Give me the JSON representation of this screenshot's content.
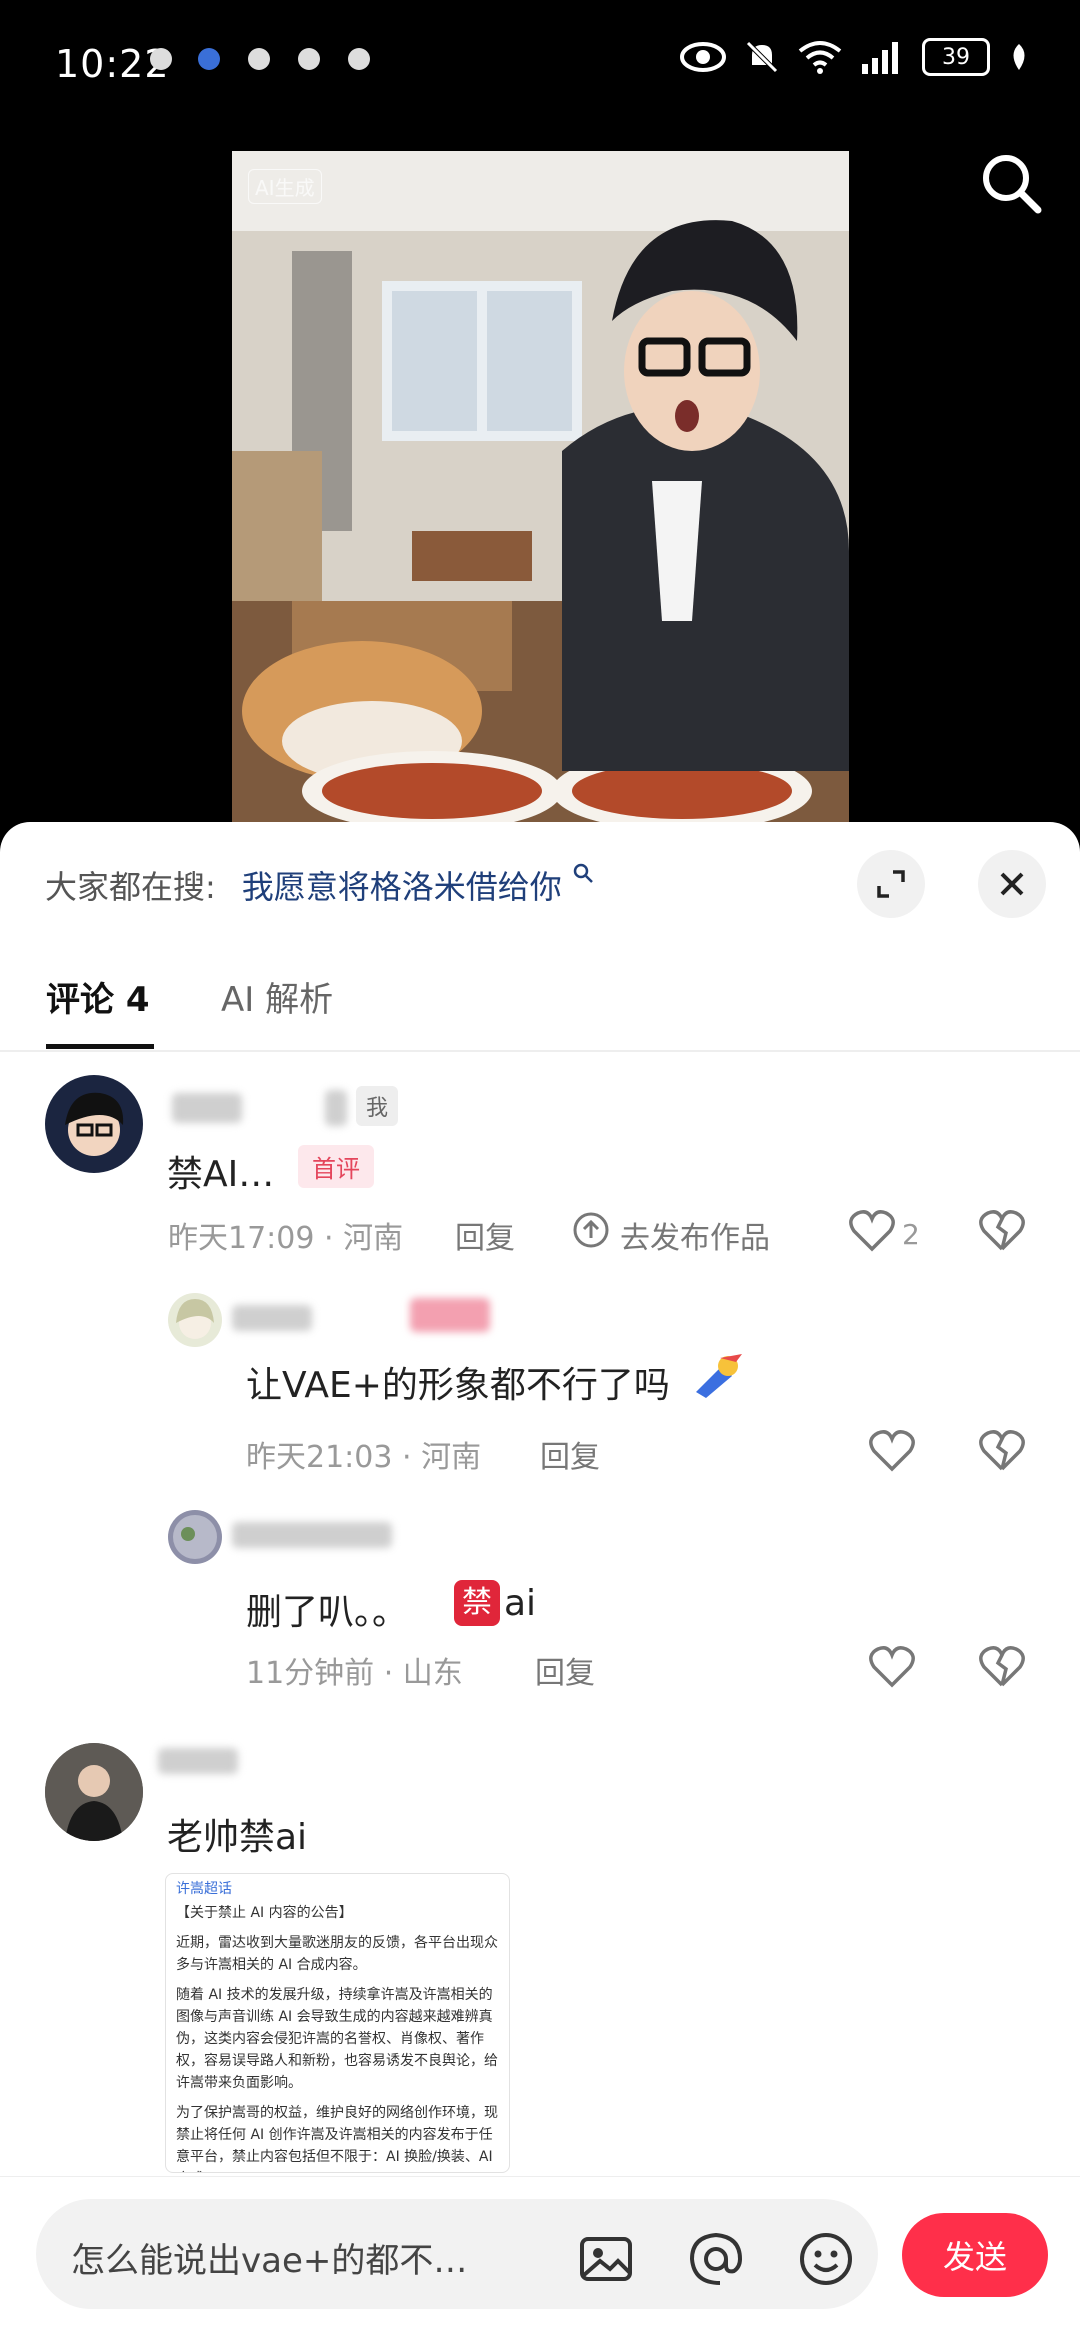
{
  "status": {
    "time": "10:22",
    "battery": "39"
  },
  "video": {
    "badge": "AI生成"
  },
  "header": {
    "search_prefix": "大家都在搜:",
    "search_query": "我愿意将格洛米借给你"
  },
  "tabs": [
    {
      "label": "评论 4"
    },
    {
      "label": "AI 解析"
    }
  ],
  "comments": [
    {
      "tag_me": "我",
      "text": "禁AI…",
      "badge": "首评",
      "time_loc": "昨天17:09 · 河南",
      "reply": "回复",
      "publish": "去发布作品",
      "likes": "2"
    },
    {
      "text": "让VAE+的形象都不行了吗",
      "time_loc": "昨天21:03 · 河南",
      "reply": "回复"
    },
    {
      "text": "删了叭。。",
      "badge": "禁",
      "suffix": "ai",
      "time_loc": "11分钟前 · 山东",
      "reply": "回复"
    },
    {
      "text": "老帅禁ai"
    }
  ],
  "notice": {
    "source": "许嵩超话",
    "title": "【关于禁止 AI 内容的公告】",
    "p1": "近期，雷达收到大量歌迷朋友的反馈，各平台出现众多与许嵩相关的 AI 合成内容。",
    "p2": "随着 AI 技术的发展升级，持续拿许嵩及许嵩相关的图像与声音训练 AI 会导致生成的内容越来越难辨真伪，这类内容会侵犯许嵩的名誉权、肖像权、著作权，容易误导路人和新粉，也容易诱发不良舆论，给许嵩带来负面影响。",
    "p3": "为了保护嵩哥的权益，维护良好的网络创作环境，现禁止将任何 AI 创作许嵩及许嵩相关的内容发布于任意平台，禁止内容包括但不限于：AI 换脸/换装、AI 合成"
  },
  "input": {
    "text": "怎么能说出vae+的都不…",
    "send": "发送"
  },
  "colors": {
    "accent": "#ff2f4a",
    "query_blue": "#1f3f7a"
  }
}
